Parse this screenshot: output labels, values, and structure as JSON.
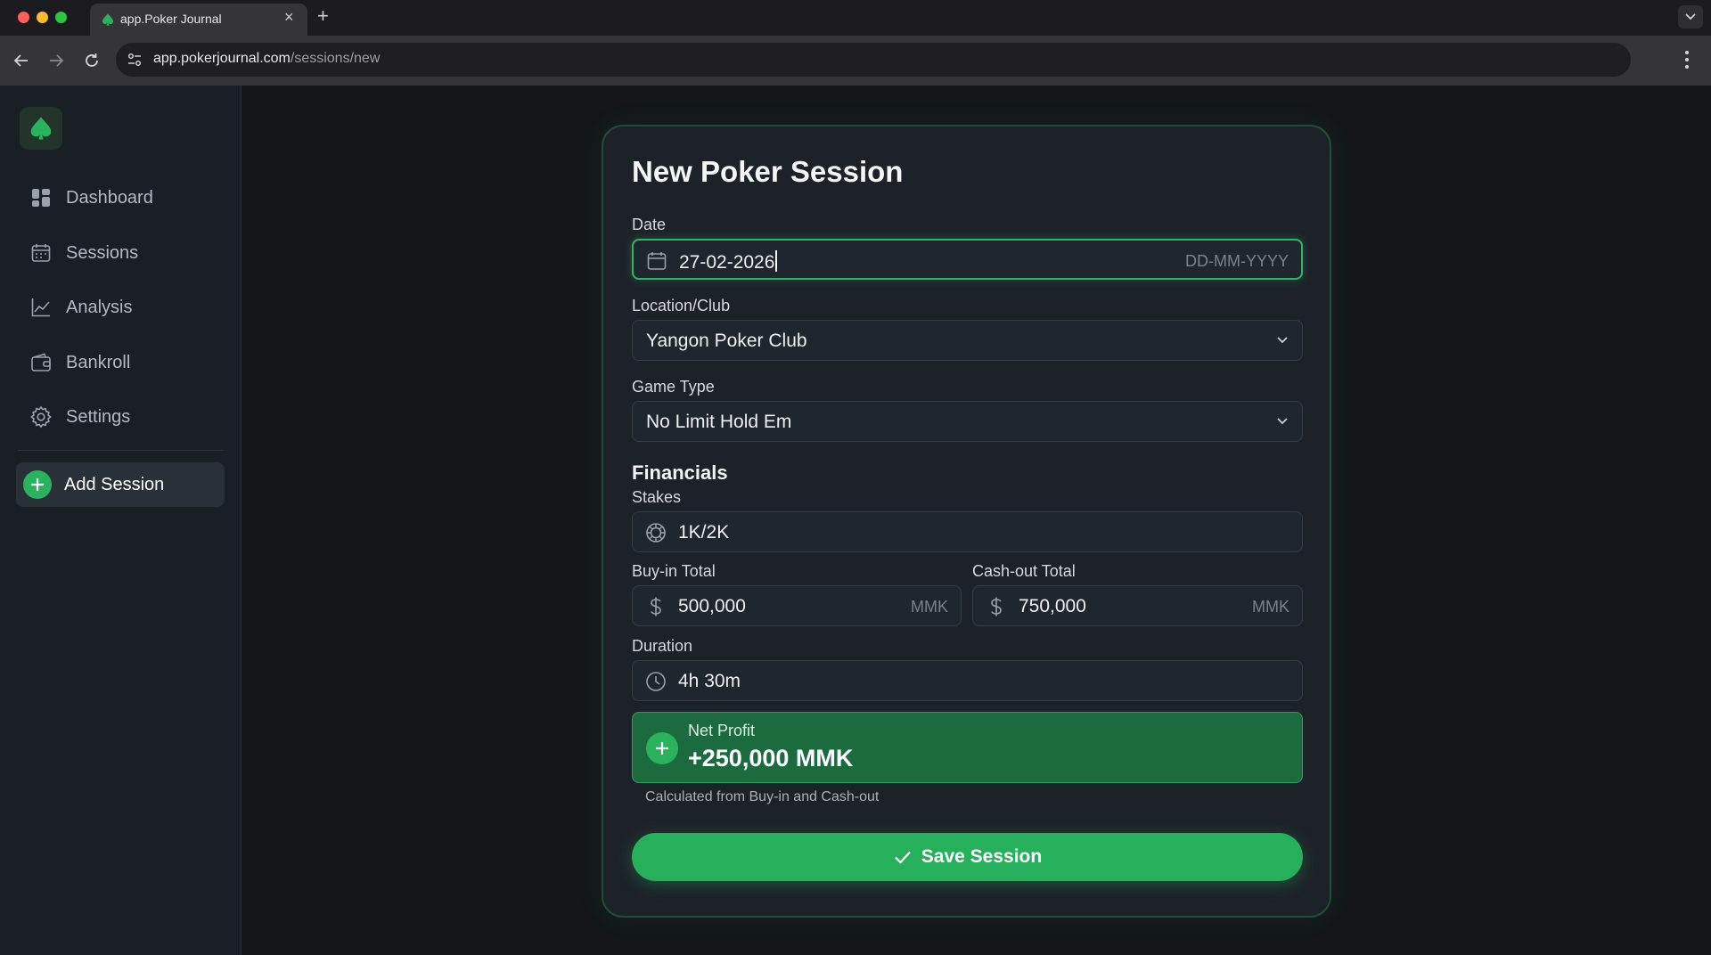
{
  "browser": {
    "tab_title": "app.Poker Journal",
    "url_domain": "app.pokerjournal.com",
    "url_path": "/sessions/new"
  },
  "sidebar": {
    "items": [
      {
        "label": "Dashboard",
        "icon": "dashboard-icon"
      },
      {
        "label": "Sessions",
        "icon": "calendar-icon"
      },
      {
        "label": "Analysis",
        "icon": "line-chart-icon"
      },
      {
        "label": "Bankroll",
        "icon": "wallet-icon"
      },
      {
        "label": "Settings",
        "icon": "gear-icon"
      }
    ],
    "add_session": "Add Session"
  },
  "form": {
    "title": "New Poker Session",
    "date": {
      "label": "Date",
      "value": "27-02-2026",
      "format_hint": "DD-MM-YYYY"
    },
    "location": {
      "label": "Location/Club",
      "value": "Yangon Poker Club"
    },
    "game_type": {
      "label": "Game Type",
      "value": "No Limit Hold Em"
    },
    "financials_heading": "Financials",
    "stakes": {
      "label": "Stakes",
      "value": "1K/2K"
    },
    "buy_in": {
      "label": "Buy-in Total",
      "value": "500,000",
      "currency": "MMK"
    },
    "cash_out": {
      "label": "Cash-out Total",
      "value": "750,000",
      "currency": "MMK"
    },
    "duration": {
      "label": "Duration",
      "value": "4h 30m"
    },
    "net_profit": {
      "label": "Net Profit",
      "value": "+250,000 MMK"
    },
    "hint": "Calculated from Buy-in and Cash-out",
    "save_label": "Save Session"
  },
  "colors": {
    "accent": "#27b05c",
    "background": "#141619",
    "card": "#1d2228"
  }
}
